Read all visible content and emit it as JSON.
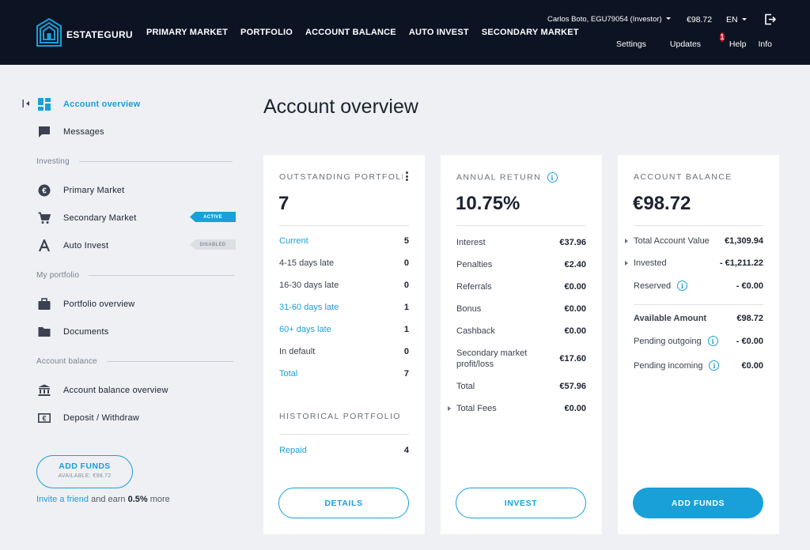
{
  "header": {
    "brand": "ESTATEGURU",
    "nav": [
      "PRIMARY MARKET",
      "PORTFOLIO",
      "ACCOUNT BALANCE",
      "AUTO INVEST",
      "SECONDARY MARKET"
    ],
    "user": "Carlos Boto, EGU79054 (Investor)",
    "balance": "€98.72",
    "language": "EN",
    "subnav": {
      "settings": "Settings",
      "updates": "Updates",
      "updates_count": "1",
      "help": "Help",
      "info": "Info"
    },
    "colors": {
      "bg": "#0c1424",
      "accent": "#19a0d9",
      "notification": "#d11a2a"
    }
  },
  "sidebar": {
    "account_overview": "Account overview",
    "messages": "Messages",
    "investing_head": "Investing",
    "primary_market": "Primary Market",
    "secondary_market": "Secondary Market",
    "secondary_badge": "ACTIVE",
    "auto_invest": "Auto Invest",
    "auto_badge": "DISABLED",
    "portfolio_head": "My portfolio",
    "portfolio_overview": "Portfolio overview",
    "documents": "Documents",
    "balance_head": "Account balance",
    "balance_overview": "Account balance overview",
    "deposit": "Deposit / Withdraw",
    "add_funds": "ADD FUNDS",
    "available": "AVAILABLE: €98.72",
    "invite_link": "Invite a friend",
    "invite_text": " and earn ",
    "invite_pct": "0.5%",
    "invite_tail": " more"
  },
  "main": {
    "title": "Account overview",
    "portfolio": {
      "head": "OUTSTANDING PORTFOLIO",
      "value": "7",
      "rows": [
        {
          "label": "Current",
          "value": "5"
        },
        {
          "label": "4-15 days late",
          "value": "0"
        },
        {
          "label": "16-30 days late",
          "value": "0"
        },
        {
          "label": "31-60 days late",
          "value": "1"
        },
        {
          "label": "60+ days late",
          "value": "1"
        },
        {
          "label": "In default",
          "value": "0"
        },
        {
          "label": "Total",
          "value": "7"
        }
      ],
      "hist_head": "HISTORICAL PORTFOLIO",
      "hist_rows": [
        {
          "label": "Repaid",
          "value": "4"
        }
      ],
      "button": "DETAILS"
    },
    "annual": {
      "head": "ANNUAL RETURN",
      "value": "10.75%",
      "rows": [
        {
          "label": "Interest",
          "value": "€37.96"
        },
        {
          "label": "Penalties",
          "value": "€2.40"
        },
        {
          "label": "Referrals",
          "value": "€0.00"
        },
        {
          "label": "Bonus",
          "value": "€0.00"
        },
        {
          "label": "Cashback",
          "value": "€0.00"
        },
        {
          "label": "Secondary market profit/loss",
          "value": "€17.60"
        },
        {
          "label": "Total",
          "value": "€57.96"
        },
        {
          "label": "Total Fees",
          "value": "€0.00"
        }
      ],
      "button": "INVEST"
    },
    "balance": {
      "head": "ACCOUNT BALANCE",
      "value": "€98.72",
      "rows": [
        {
          "label": "Total Account Value",
          "value": "€1,309.94"
        },
        {
          "label": "Invested",
          "value": "- €1,211.22"
        },
        {
          "label": "Reserved",
          "value": "- €0.00"
        },
        {
          "label": "Available Amount",
          "value": "€98.72"
        },
        {
          "label": "Pending outgoing",
          "value": "- €0.00"
        },
        {
          "label": "Pending incoming",
          "value": "€0.00"
        }
      ],
      "button": "ADD FUNDS"
    }
  }
}
